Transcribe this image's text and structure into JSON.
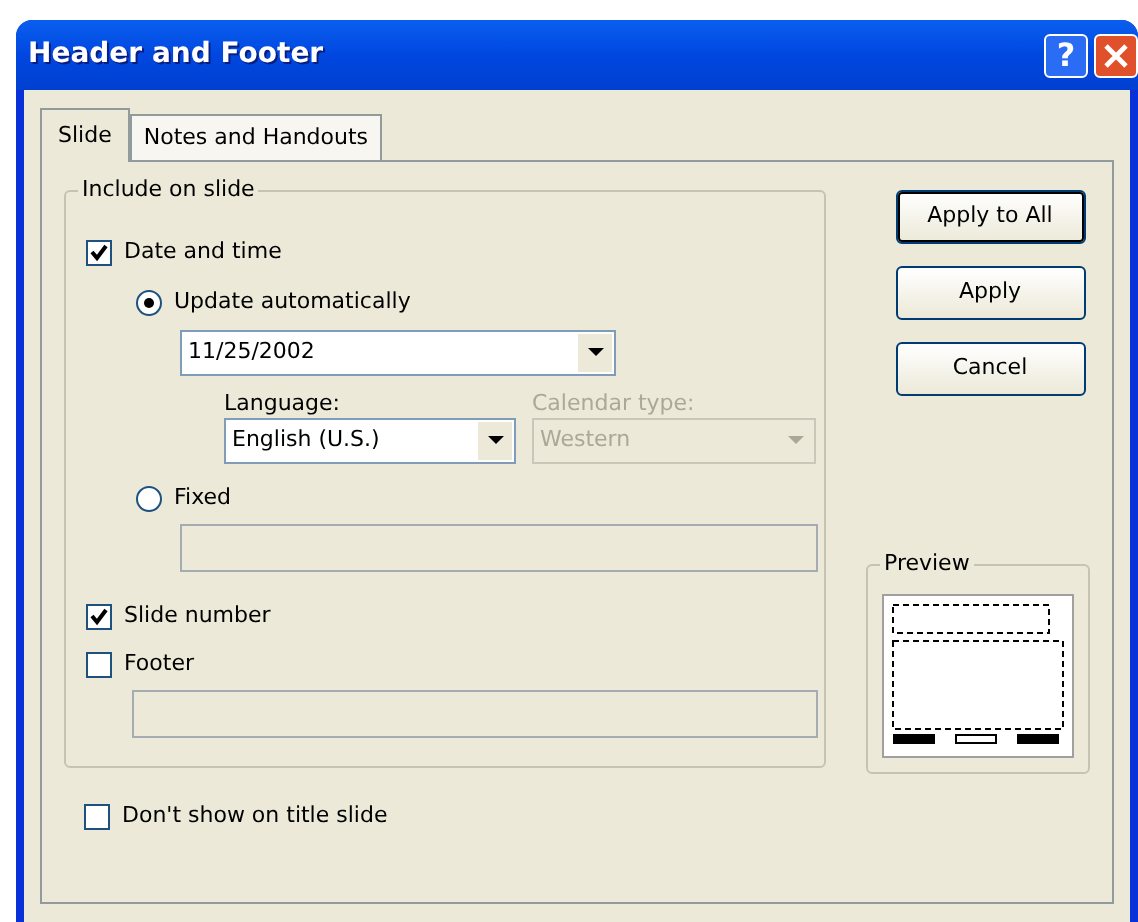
{
  "window": {
    "title": "Header and Footer",
    "help_glyph": "?"
  },
  "tabs": [
    {
      "label": "Slide",
      "selected": true
    },
    {
      "label": "Notes and Handouts",
      "selected": false
    }
  ],
  "group": {
    "title": "Include on slide",
    "date_time": {
      "label": "Date and time",
      "checked": true
    },
    "update_automatically": {
      "label": "Update automatically",
      "selected": true,
      "value": "11/25/2002"
    },
    "language": {
      "label": "Language:",
      "value": "English (U.S.)",
      "disabled": false
    },
    "calendar_type": {
      "label": "Calendar type:",
      "value": "Western",
      "disabled": true
    },
    "fixed": {
      "label": "Fixed",
      "selected": false
    },
    "slide_number": {
      "label": "Slide number",
      "checked": true
    },
    "footer": {
      "label": "Footer",
      "checked": false
    }
  },
  "dont_show_on_title": {
    "label": "Don't show on title slide",
    "checked": false
  },
  "buttons": [
    {
      "label": "Apply to All",
      "default": true
    },
    {
      "label": "Apply",
      "default": false
    },
    {
      "label": "Cancel",
      "default": false
    }
  ],
  "preview": {
    "title": "Preview"
  }
}
